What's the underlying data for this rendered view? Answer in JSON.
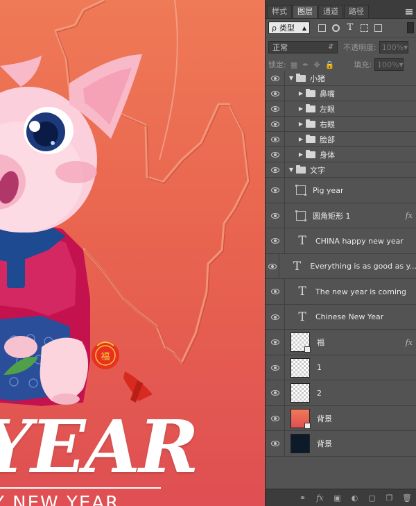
{
  "canvas": {
    "big_text": "YEAR",
    "sub_text": "Y NEW YEAR",
    "tag_char": "福"
  },
  "panel": {
    "tabs": [
      {
        "label": "样式",
        "active": false
      },
      {
        "label": "图层",
        "active": true
      },
      {
        "label": "通道",
        "active": false
      },
      {
        "label": "路径",
        "active": false
      }
    ],
    "filter": {
      "kind_label": "类型",
      "search_glyph": "ρ"
    },
    "blend": {
      "mode": "正常",
      "opacity_label": "不透明度:",
      "opacity_value": "100%"
    },
    "lock": {
      "label": "锁定:",
      "fill_label": "填充:",
      "fill_value": "100%"
    },
    "layers": [
      {
        "name": "小猪",
        "type": "group",
        "expanded": true,
        "indent": 0,
        "height": 21
      },
      {
        "name": "鼻嘴",
        "type": "group",
        "expanded": false,
        "indent": 1,
        "height": 21
      },
      {
        "name": "左眼",
        "type": "group",
        "expanded": false,
        "indent": 1,
        "height": 21
      },
      {
        "name": "右眼",
        "type": "group",
        "expanded": false,
        "indent": 1,
        "height": 21
      },
      {
        "name": "脸部",
        "type": "group",
        "expanded": false,
        "indent": 1,
        "height": 21
      },
      {
        "name": "身体",
        "type": "group",
        "expanded": false,
        "indent": 1,
        "height": 21
      },
      {
        "name": "文字",
        "type": "group",
        "expanded": true,
        "indent": 0,
        "height": 21
      },
      {
        "name": "Pig year",
        "type": "shape",
        "fx": false,
        "height": 36
      },
      {
        "name": "圆角矩形 1",
        "type": "shape",
        "fx": true,
        "height": 35
      },
      {
        "name": "CHINA  happy new year",
        "type": "text",
        "fx": false,
        "height": 36
      },
      {
        "name": "Everything is as good as y...",
        "type": "text",
        "fx": false,
        "height": 35
      },
      {
        "name": "The new year is coming",
        "type": "text",
        "fx": false,
        "height": 36
      },
      {
        "name": "Chinese  New Year",
        "type": "text",
        "fx": false,
        "height": 35
      },
      {
        "name": "福",
        "type": "pixel",
        "fx": true,
        "smart": true,
        "height": 36
      },
      {
        "name": "1",
        "type": "pixel",
        "fx": false,
        "height": 35
      },
      {
        "name": "2",
        "type": "pixel",
        "fx": false,
        "height": 36
      },
      {
        "name": "背景",
        "type": "pixel",
        "fx": false,
        "thumb": "gradient",
        "smart": true,
        "height": 35
      },
      {
        "name": "背景",
        "type": "pixel",
        "fx": false,
        "thumb": "dark",
        "height": 36
      }
    ],
    "fx_label": "fx"
  }
}
